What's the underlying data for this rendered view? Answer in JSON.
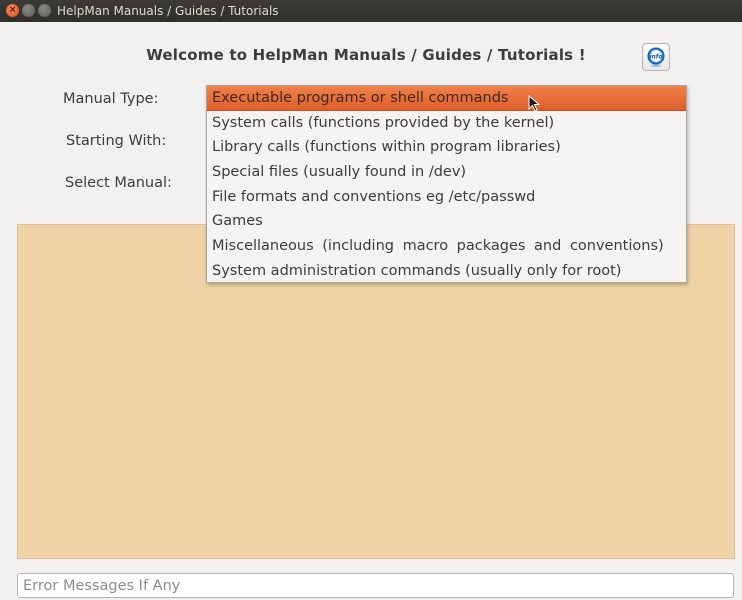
{
  "window": {
    "title": "HelpMan Manuals / Guides / Tutorials",
    "buttons": {
      "close": "×",
      "minimize": "",
      "maximize": ""
    }
  },
  "header": {
    "welcome": "Welcome to HelpMan Manuals / Guides / Tutorials !",
    "info_icon": "info-icon",
    "info_icon_text": "info"
  },
  "form": {
    "manual_type_label": "Manual Type:",
    "starting_with_label": "Starting With:",
    "select_manual_label": "Select Manual:"
  },
  "dropdown": {
    "selected_index": 0,
    "items": [
      "Executable programs or shell commands",
      "System calls (functions provided by the kernel)",
      "Library calls (functions within program libraries)",
      "Special files (usually found in /dev)",
      "File formats and conventions eg /etc/passwd",
      "Games",
      "Miscellaneous (including macro packages and conventions)",
      "System administration commands (usually only for root)"
    ]
  },
  "error_field": {
    "value": "",
    "placeholder": "Error Messages If Any"
  },
  "colors": {
    "content_bg": "#efd3a7",
    "selection_accent": "#e8703a",
    "titlebar": "#3c3b37"
  }
}
